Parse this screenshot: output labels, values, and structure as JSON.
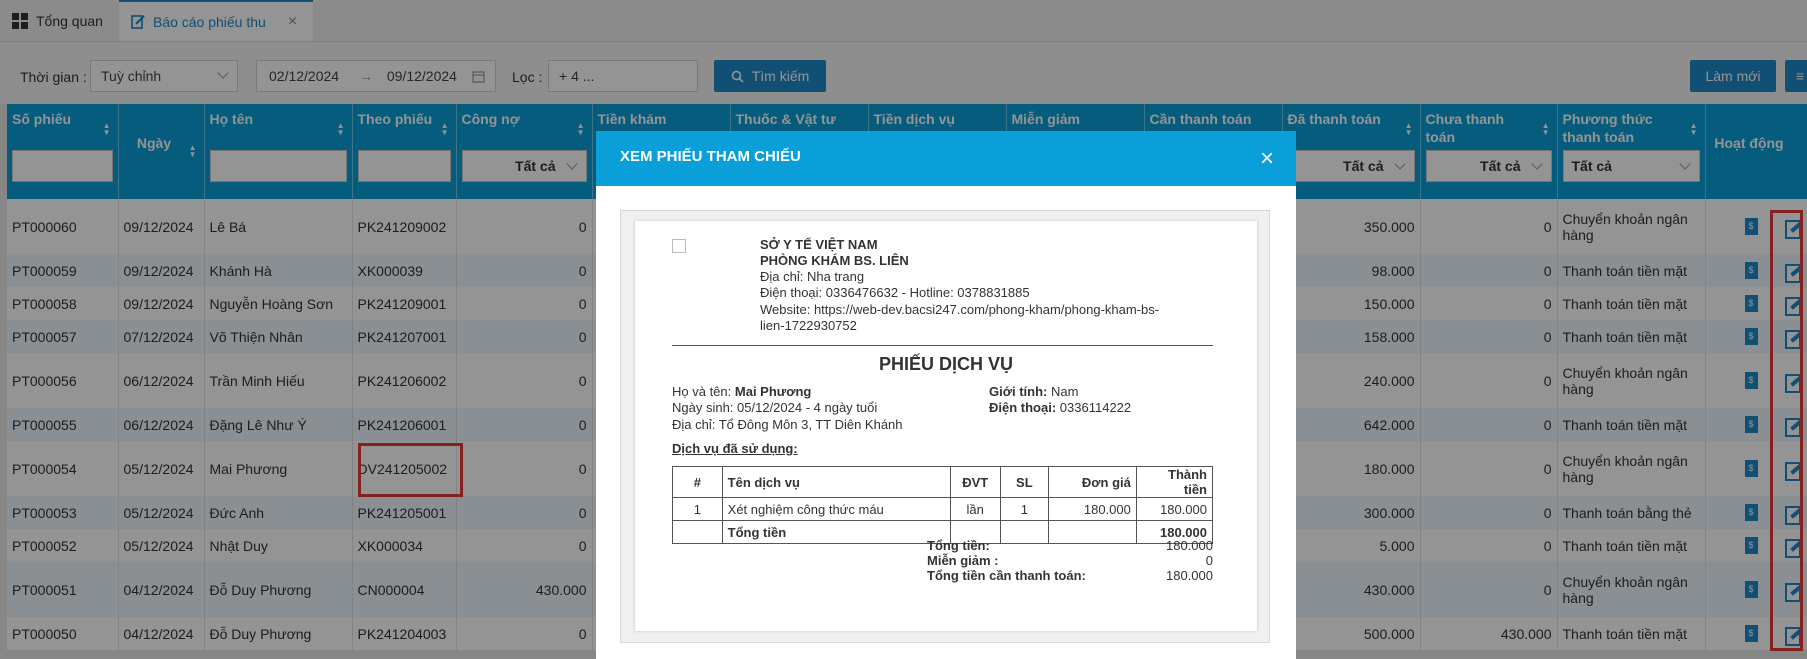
{
  "tabs": {
    "overview": "Tổng quan",
    "report": "Báo cáo phiếu thu"
  },
  "filters": {
    "time_label": "Thời gian :",
    "time_value": "Tuỳ chỉnh",
    "date_from": "02/12/2024",
    "date_to": "09/12/2024",
    "filter_label": "Lọc :",
    "filter_value": "+ 4 ...",
    "search_button": "Tìm kiếm",
    "refresh_button": "Làm mới"
  },
  "columns": {
    "c0": "Số phiếu",
    "c1": "Ngày",
    "c2": "Họ tên",
    "c3": "Theo phiếu",
    "c4": "Công nợ",
    "c5": "Tiền khám",
    "c6": "Thuốc & Vật tư",
    "c7": "Tiền dịch vụ",
    "c8": "Miễn giảm",
    "c9": "Cần thanh toán",
    "c10": "Đã thanh toán",
    "c11": "Chưa thanh toán",
    "c12": "Phương thức thanh toán",
    "c13": "Hoạt động",
    "all": "Tất cả"
  },
  "rows": [
    {
      "so": "PT000060",
      "ngay": "09/12/2024",
      "ten": "Lê Bá",
      "theo": "PK241209002",
      "congno": "0",
      "dathanhtoan": "350.000",
      "chua": "0",
      "pt": "Chuyển khoản ngân hàng"
    },
    {
      "so": "PT000059",
      "ngay": "09/12/2024",
      "ten": "Khánh Hà",
      "theo": "XK000039",
      "congno": "0",
      "dathanhtoan": "98.000",
      "chua": "0",
      "pt": "Thanh toán tiền mặt"
    },
    {
      "so": "PT000058",
      "ngay": "09/12/2024",
      "ten": "Nguyễn Hoàng Sơn",
      "theo": "PK241209001",
      "congno": "0",
      "dathanhtoan": "150.000",
      "chua": "0",
      "pt": "Thanh toán tiền mặt"
    },
    {
      "so": "PT000057",
      "ngay": "07/12/2024",
      "ten": "Võ Thiện Nhân",
      "theo": "PK241207001",
      "congno": "0",
      "dathanhtoan": "158.000",
      "chua": "0",
      "pt": "Thanh toán tiền mặt"
    },
    {
      "so": "PT000056",
      "ngay": "06/12/2024",
      "ten": "Trần Minh Hiếu",
      "theo": "PK241206002",
      "congno": "0",
      "dathanhtoan": "240.000",
      "chua": "0",
      "pt": "Chuyển khoản ngân hàng"
    },
    {
      "so": "PT000055",
      "ngay": "06/12/2024",
      "ten": "Đặng Lê Như Ý",
      "theo": "PK241206001",
      "congno": "0",
      "dathanhtoan": "642.000",
      "chua": "0",
      "pt": "Thanh toán tiền mặt"
    },
    {
      "so": "PT000054",
      "ngay": "05/12/2024",
      "ten": "Mai Phương",
      "theo": "DV241205002",
      "congno": "0",
      "dathanhtoan": "180.000",
      "chua": "0",
      "pt": "Chuyển khoản ngân hàng"
    },
    {
      "so": "PT000053",
      "ngay": "05/12/2024",
      "ten": "Đức Anh",
      "theo": "PK241205001",
      "congno": "0",
      "dathanhtoan": "300.000",
      "chua": "0",
      "pt": "Thanh toán bằng thẻ"
    },
    {
      "so": "PT000052",
      "ngay": "05/12/2024",
      "ten": "Nhật Duy",
      "theo": "XK000034",
      "congno": "0",
      "dathanhtoan": "5.000",
      "chua": "0",
      "pt": "Thanh toán tiền mặt"
    },
    {
      "so": "PT000051",
      "ngay": "04/12/2024",
      "ten": "Đỗ Duy Phương",
      "theo": "CN000004",
      "congno": "430.000",
      "dathanhtoan": "430.000",
      "chua": "0",
      "pt": "Chuyển khoản ngân hàng"
    },
    {
      "so": "PT000050",
      "ngay": "04/12/2024",
      "ten": "Đỗ Duy Phương",
      "theo": "PK241204003",
      "congno": "0",
      "dathanhtoan": "500.000",
      "chua": "430.000",
      "pt": "Thanh toán tiền mặt"
    }
  ],
  "modal": {
    "title": "XEM PHIẾU THAM CHIẾU",
    "org": "SỞ Y TẾ VIỆT NAM",
    "clinic": "PHÒNG KHÁM BS. LIÊN",
    "address": "Địa chỉ: Nha trang",
    "phone": "Điện thoại: 0336476632 - Hotline: 0378831885",
    "website1": "Website: https://web-dev.bacsi247.com/phong-kham/phong-kham-bs-",
    "website2": "lien-1722930752",
    "doc_title": "PHIẾU DỊCH VỤ",
    "name_label": "Họ và tên:",
    "name_value": "Mai Phương",
    "dob": "Ngày sinh: 05/12/2024 - 4 ngày tuổi",
    "address_patient": "Địa chỉ: Tổ Đông Môn 3, TT Diên Khánh",
    "gender_label": "Giới tính:",
    "gender_value": "Nam",
    "phone_label": "Điện thoại:",
    "phone_value": "0336114222",
    "services_heading": "Dịch vụ đã sử dụng:",
    "svc_headers": {
      "no": "#",
      "name": "Tên dịch vụ",
      "unit": "ĐVT",
      "qty": "SL",
      "price": "Đơn giá",
      "amount": "Thành tiền"
    },
    "svc_rows": [
      {
        "no": "1",
        "name": "Xét nghiệm công thức máu",
        "unit": "lần",
        "qty": "1",
        "price": "180.000",
        "amount": "180.000"
      }
    ],
    "svc_total_label": "Tổng tiền",
    "svc_total_value": "180.000",
    "sum_total_label": "Tổng tiền:",
    "sum_total_value": "180.000",
    "sum_discount_label": "Miễn giảm :",
    "sum_discount_value": "0",
    "sum_due_label": "Tổng tiền cần thanh toán:",
    "sum_due_value": "180.000"
  },
  "colors": {
    "accent": "#0a9fd8",
    "highlight": "#e53935"
  }
}
